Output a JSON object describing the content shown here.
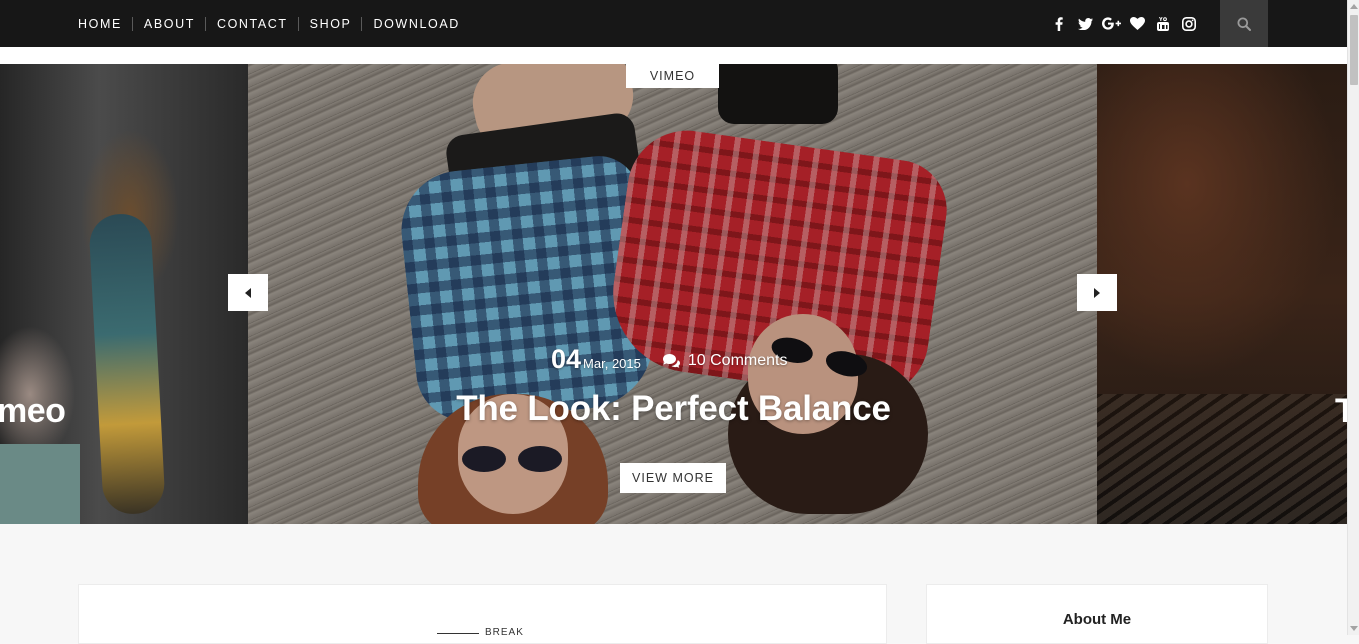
{
  "nav": {
    "items": [
      {
        "label": "HOME"
      },
      {
        "label": "ABOUT"
      },
      {
        "label": "CONTACT"
      },
      {
        "label": "SHOP"
      },
      {
        "label": "DOWNLOAD"
      }
    ],
    "socials": [
      "facebook-icon",
      "twitter-icon",
      "google-plus-icon",
      "heart-icon",
      "youtube-icon",
      "instagram-icon"
    ],
    "search_icon": "search-icon"
  },
  "slider": {
    "left_slide_title": "meo",
    "right_slide_title": "T",
    "active": {
      "category": "VIMEO",
      "day": "04",
      "date": "Mar, 2015",
      "comments": "10 Comments",
      "title": "The Look: Perfect Balance",
      "cta": "VIEW MORE"
    }
  },
  "content": {
    "post_category": "BREAK"
  },
  "sidebar": {
    "title": "About Me"
  },
  "colors": {
    "topbar": "#171717",
    "search_bg": "#3a3a3a",
    "page_bg": "#f7f7f7"
  }
}
